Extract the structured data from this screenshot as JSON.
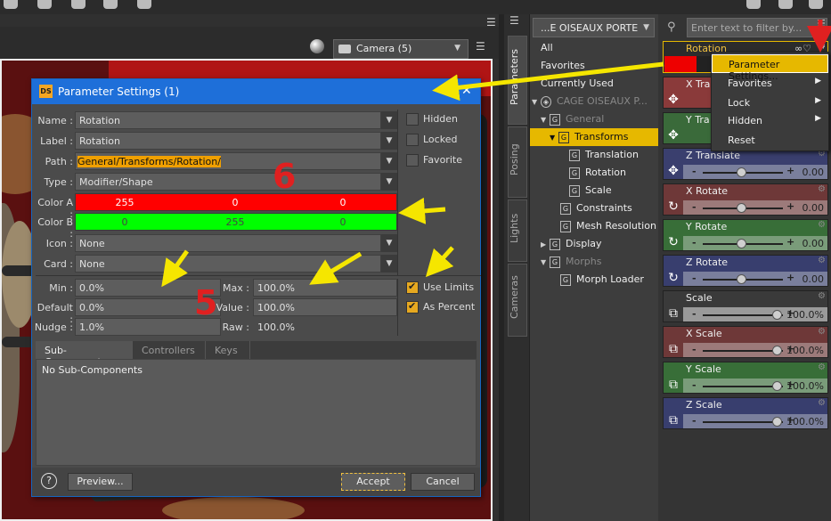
{
  "viewport": {
    "camera_label": "Camera (5)"
  },
  "dialog": {
    "title": "Parameter Settings (1)",
    "logo": "DS",
    "labels": {
      "name": "Name :",
      "label": "Label :",
      "path": "Path :",
      "type": "Type :",
      "color_a": "Color A :",
      "color_b": "Color B :",
      "icon": "Icon :",
      "card": "Card :",
      "min": "Min :",
      "default": "Default :",
      "nudge": "Nudge :",
      "max": "Max :",
      "value": "Value :",
      "raw": "Raw :"
    },
    "values": {
      "name": "Rotation",
      "label": "Rotation",
      "path": "General/Transforms/Rotation/",
      "type": "Modifier/Shape",
      "icon": "None",
      "card": "None",
      "min": "0.0%",
      "default": "0.0%",
      "nudge": "1.0%",
      "max": "100.0%",
      "value": "100.0%",
      "raw": "100.0%"
    },
    "color_a": {
      "r": "255",
      "g": "0",
      "b": "0",
      "hex": "#ff0000"
    },
    "color_b": {
      "r": "0",
      "g": "255",
      "b": "0",
      "hex": "#00ff00"
    },
    "checkboxes": {
      "hidden": "Hidden",
      "locked": "Locked",
      "favorite": "Favorite",
      "use_limits": "Use Limits",
      "as_percent": "As Percent"
    },
    "tabs": [
      "Sub-Components",
      "Controllers",
      "Keys"
    ],
    "tab_body": "No Sub-Components",
    "buttons": {
      "help": "?",
      "preview": "Preview...",
      "accept": "Accept",
      "cancel": "Cancel"
    }
  },
  "annotations": {
    "six": "6",
    "five": "5"
  },
  "side_tabs": [
    "Parameters",
    "Posing",
    "Lights",
    "Cameras"
  ],
  "tree": {
    "figure": "...E OISEAUX PORTE",
    "rows": [
      {
        "label": "All"
      },
      {
        "label": "Favorites"
      },
      {
        "label": "Currently Used"
      },
      {
        "label": "CAGE OISEAUX P..."
      },
      {
        "label": "General"
      },
      {
        "label": "Transforms"
      },
      {
        "label": "Translation"
      },
      {
        "label": "Rotation"
      },
      {
        "label": "Scale"
      },
      {
        "label": "Constraints"
      },
      {
        "label": "Mesh Resolution"
      },
      {
        "label": "Display"
      },
      {
        "label": "Morphs"
      },
      {
        "label": "Morph Loader"
      }
    ]
  },
  "params": {
    "filter_placeholder": "Enter text to filter by...",
    "cards": [
      {
        "name": "Rotation",
        "value": ""
      },
      {
        "name": "X Tra",
        "value": ""
      },
      {
        "name": "Y Tra",
        "value": ""
      },
      {
        "name": "Z Translate",
        "value": "0.00"
      },
      {
        "name": "X Rotate",
        "value": "0.00"
      },
      {
        "name": "Y Rotate",
        "value": "0.00"
      },
      {
        "name": "Z Rotate",
        "value": "0.00"
      },
      {
        "name": "Scale",
        "value": "100.0%"
      },
      {
        "name": "X Scale",
        "value": "100.0%"
      },
      {
        "name": "Y Scale",
        "value": "100.0%"
      },
      {
        "name": "Z Scale",
        "value": "100.0%"
      }
    ],
    "slider_minus": "-",
    "slider_plus": "+"
  },
  "context_menu": {
    "items": [
      "Parameter Settings...",
      "Favorites",
      "Lock",
      "Hidden",
      "Reset"
    ]
  },
  "colors": {
    "accent_yellow": "#e6b800",
    "title_blue": "#1e6fd9",
    "arrow_yellow": "#f5e600",
    "arrow_red": "#e02020"
  }
}
